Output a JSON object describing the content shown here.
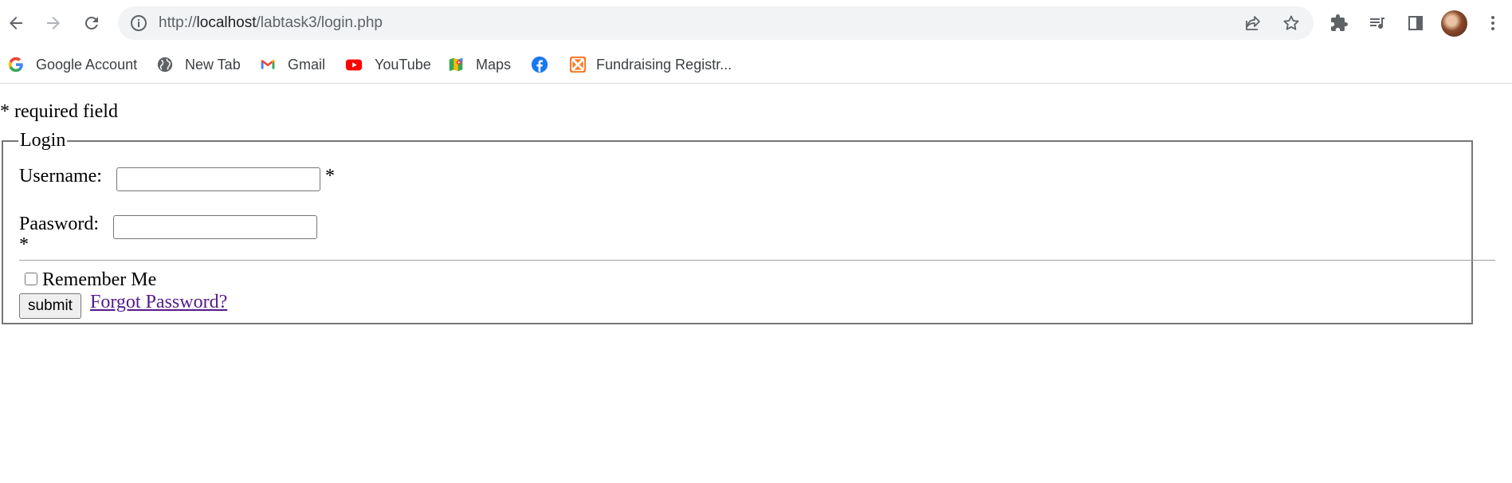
{
  "browser": {
    "url_scheme": "http://",
    "url_host": "localhost",
    "url_path": "/labtask3/login.php",
    "bookmarks": [
      {
        "label": "Google Account",
        "icon": "google-icon"
      },
      {
        "label": "New Tab",
        "icon": "globe-icon"
      },
      {
        "label": "Gmail",
        "icon": "gmail-icon"
      },
      {
        "label": "YouTube",
        "icon": "youtube-icon"
      },
      {
        "label": "Maps",
        "icon": "maps-icon"
      },
      {
        "label": "",
        "icon": "facebook-icon"
      },
      {
        "label": "Fundraising Registr...",
        "icon": "xampp-icon"
      }
    ]
  },
  "page": {
    "required_note": "* required field",
    "legend": "Login",
    "username_label": "Username:",
    "username_value": "",
    "username_required": "*",
    "password_label": "Paasword:",
    "password_value": "",
    "password_required": "*",
    "remember_label": "Remember Me",
    "remember_checked": false,
    "submit_label": "submit",
    "forgot_link": "Forgot Password?"
  }
}
